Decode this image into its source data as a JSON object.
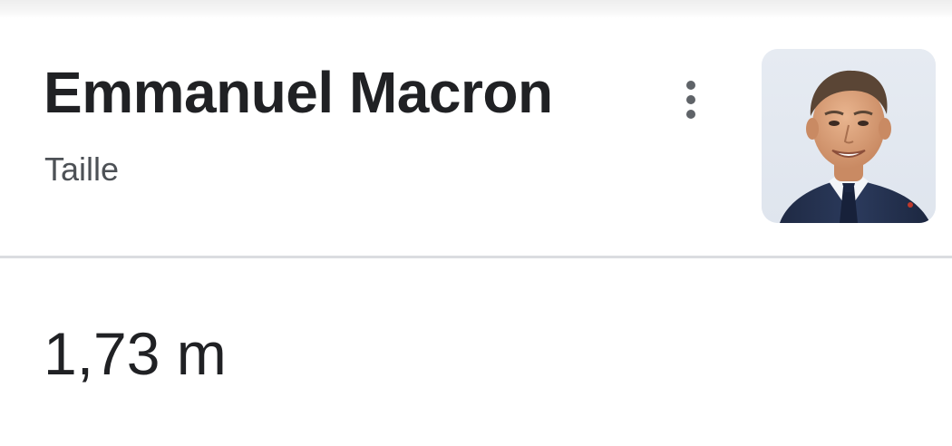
{
  "card": {
    "title": "Emmanuel Macron",
    "subtitle": "Taille",
    "value": "1,73 m",
    "more_menu_icon": "more-vert-icon",
    "thumbnail_alt": "Emmanuel Macron"
  },
  "colors": {
    "title": "#202124",
    "subtitle": "#4d5156",
    "divider": "#dadce0",
    "icon": "#5f6368"
  }
}
